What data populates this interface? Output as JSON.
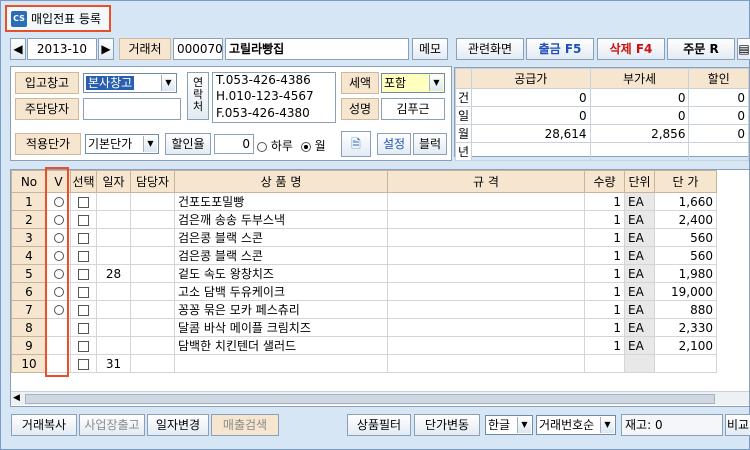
{
  "window": {
    "title": "매입전표 등록",
    "app_icon": "CS"
  },
  "toolbar": {
    "month": "2013-10",
    "vendor_label": "거래처",
    "vendor_code": "000070",
    "vendor_name": "고릴라빵집",
    "memo": "메모",
    "related": "관련화면",
    "print": "출금 F5",
    "delete": "삭제 F4",
    "order": "주문 R"
  },
  "form": {
    "warehouse_label": "입고창고",
    "warehouse_value": "본사창고",
    "manager_label": "주담당자",
    "contact_label": "연락처",
    "tel": "T.053-426-4386",
    "hp": "H.010-123-4567",
    "fax": "F.053-426-4380",
    "tax_label": "세액",
    "tax_value": "포함",
    "name_label": "성명",
    "name_value": "김푸근",
    "price_label": "적용단가",
    "price_value": "기본단가",
    "discount_label": "할인율",
    "discount_value": "0",
    "opt_day": "하루",
    "opt_month": "월",
    "settings": "설정",
    "block": "블럭"
  },
  "summary": {
    "headers": [
      "공급가",
      "부가세",
      "할인"
    ],
    "side": [
      "건",
      "일",
      "월",
      "년"
    ],
    "rows": [
      [
        "0",
        "0",
        "0"
      ],
      [
        "0",
        "0",
        "0"
      ],
      [
        "28,614",
        "2,856",
        "0"
      ],
      [
        "",
        "",
        ""
      ]
    ]
  },
  "grid": {
    "headers": [
      "No",
      "V",
      "선택",
      "일자",
      "담당자",
      "상 품 명",
      "규 격",
      "수량",
      "단위",
      "단 가"
    ],
    "rows": [
      {
        "no": "1",
        "v": true,
        "date": "",
        "name": "건포도포밀빵",
        "qty": "1",
        "unit": "EA",
        "price": "1,660"
      },
      {
        "no": "2",
        "v": true,
        "date": "",
        "name": "검은깨 송송 두부스낵",
        "qty": "1",
        "unit": "EA",
        "price": "2,400"
      },
      {
        "no": "3",
        "v": true,
        "date": "",
        "name": "검은콩 블랙 스콘",
        "qty": "1",
        "unit": "EA",
        "price": "560"
      },
      {
        "no": "4",
        "v": true,
        "date": "",
        "name": "검은콩 블랙 스콘",
        "qty": "1",
        "unit": "EA",
        "price": "560"
      },
      {
        "no": "5",
        "v": true,
        "date": "28",
        "name": "겉도 속도 왕창치즈",
        "qty": "1",
        "unit": "EA",
        "price": "1,980"
      },
      {
        "no": "6",
        "v": true,
        "date": "",
        "name": "고소 담백 두유케이크",
        "qty": "1",
        "unit": "EA",
        "price": "19,000"
      },
      {
        "no": "7",
        "v": true,
        "date": "",
        "name": "꽁꽁 묶은 모카 페스츄리",
        "qty": "1",
        "unit": "EA",
        "price": "880"
      },
      {
        "no": "8",
        "v": false,
        "date": "",
        "name": "달콤 바삭 메이플 크림치즈",
        "qty": "1",
        "unit": "EA",
        "price": "2,330"
      },
      {
        "no": "9",
        "v": false,
        "date": "",
        "name": "담백한 치킨텐더 샐러드",
        "qty": "1",
        "unit": "EA",
        "price": "2,100"
      },
      {
        "no": "10",
        "v": false,
        "date": "31",
        "name": "",
        "qty": "",
        "unit": "",
        "price": ""
      }
    ]
  },
  "footer": {
    "copy": "거래복사",
    "business": "사업장출고",
    "date_change": "일자변경",
    "sales_search": "매출검색",
    "product_filter": "상품필터",
    "price_change": "단가변동",
    "lang": "한글",
    "sort": "거래번호순",
    "stock": "재고: 0",
    "compare": "비교"
  },
  "colors": {
    "highlight": "#e8502a",
    "label_bg": "#f7e6cf",
    "blue": "#1f4fb8",
    "red": "#cc1010"
  }
}
